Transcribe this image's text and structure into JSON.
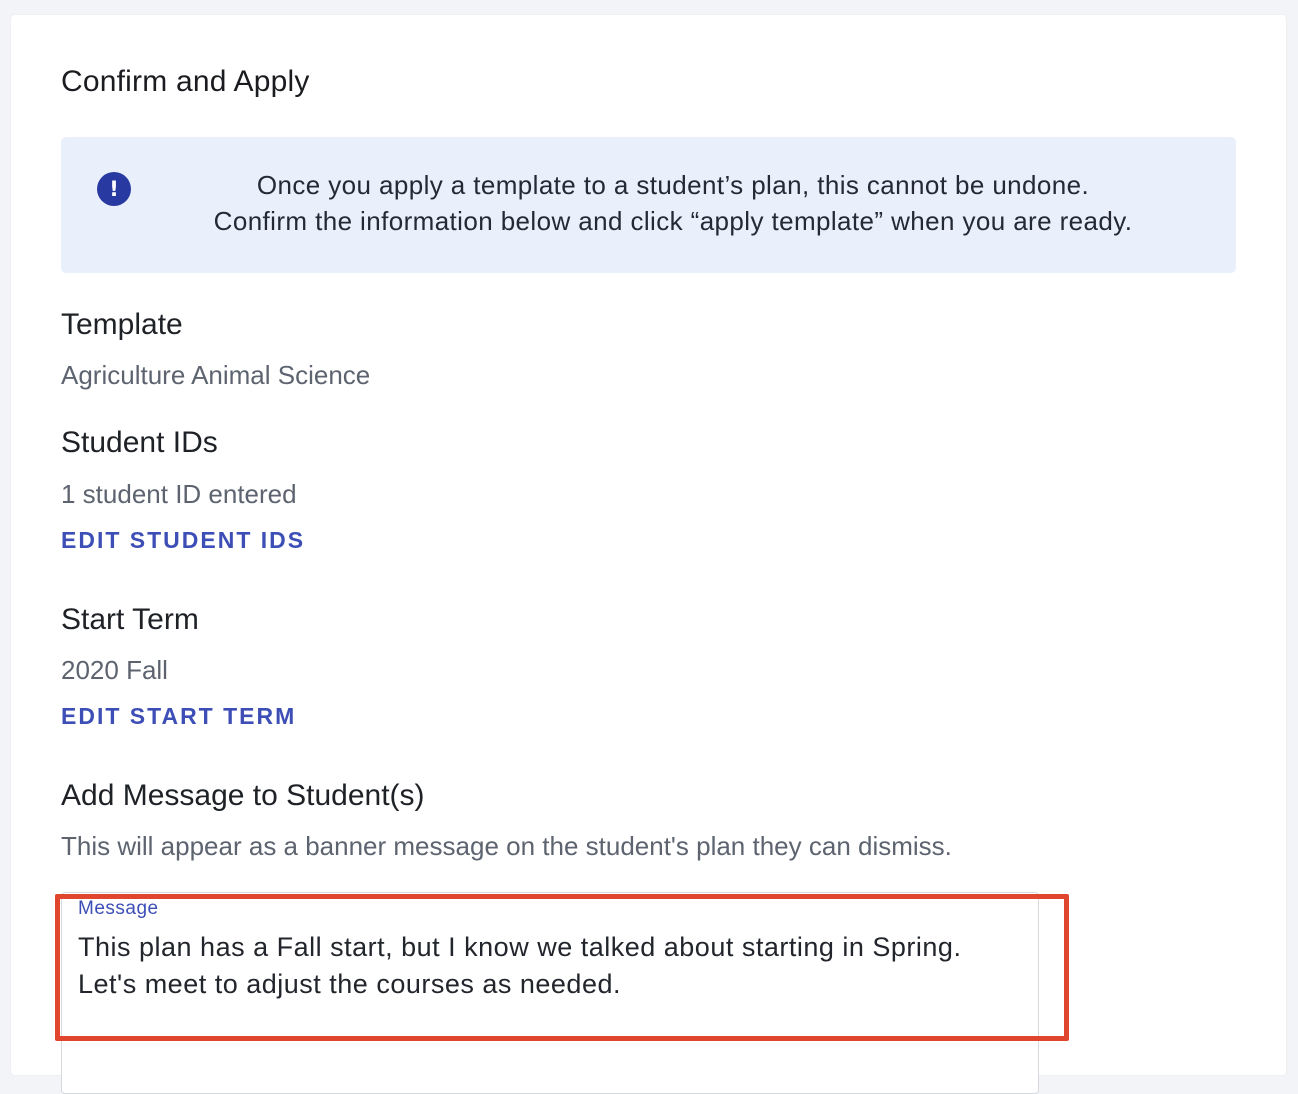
{
  "page": {
    "title": "Confirm and Apply"
  },
  "banner": {
    "icon": "exclamation-circle-icon",
    "line1": "Once you apply a template to a student’s plan, this cannot be undone.",
    "line2": "Confirm the information below and click “apply template” when you are ready."
  },
  "template": {
    "heading": "Template",
    "value": "Agriculture Animal Science"
  },
  "student_ids": {
    "heading": "Student IDs",
    "value": "1 student ID entered",
    "edit_label": "EDIT STUDENT IDS"
  },
  "start_term": {
    "heading": "Start Term",
    "value": "2020 Fall",
    "edit_label": "EDIT START TERM"
  },
  "message_section": {
    "heading": "Add Message to Student(s)",
    "description": "This will appear as a banner message on the student's plan they can dismiss.",
    "field_label": "Message",
    "field_value": "This plan has a Fall start, but I know we talked about starting in Spring. Let's meet to adjust the courses as needed."
  },
  "colors": {
    "accent": "#3d4fb6",
    "info_background": "#e9effb",
    "info_icon": "#283aa1",
    "highlight_border": "#e0452d"
  }
}
